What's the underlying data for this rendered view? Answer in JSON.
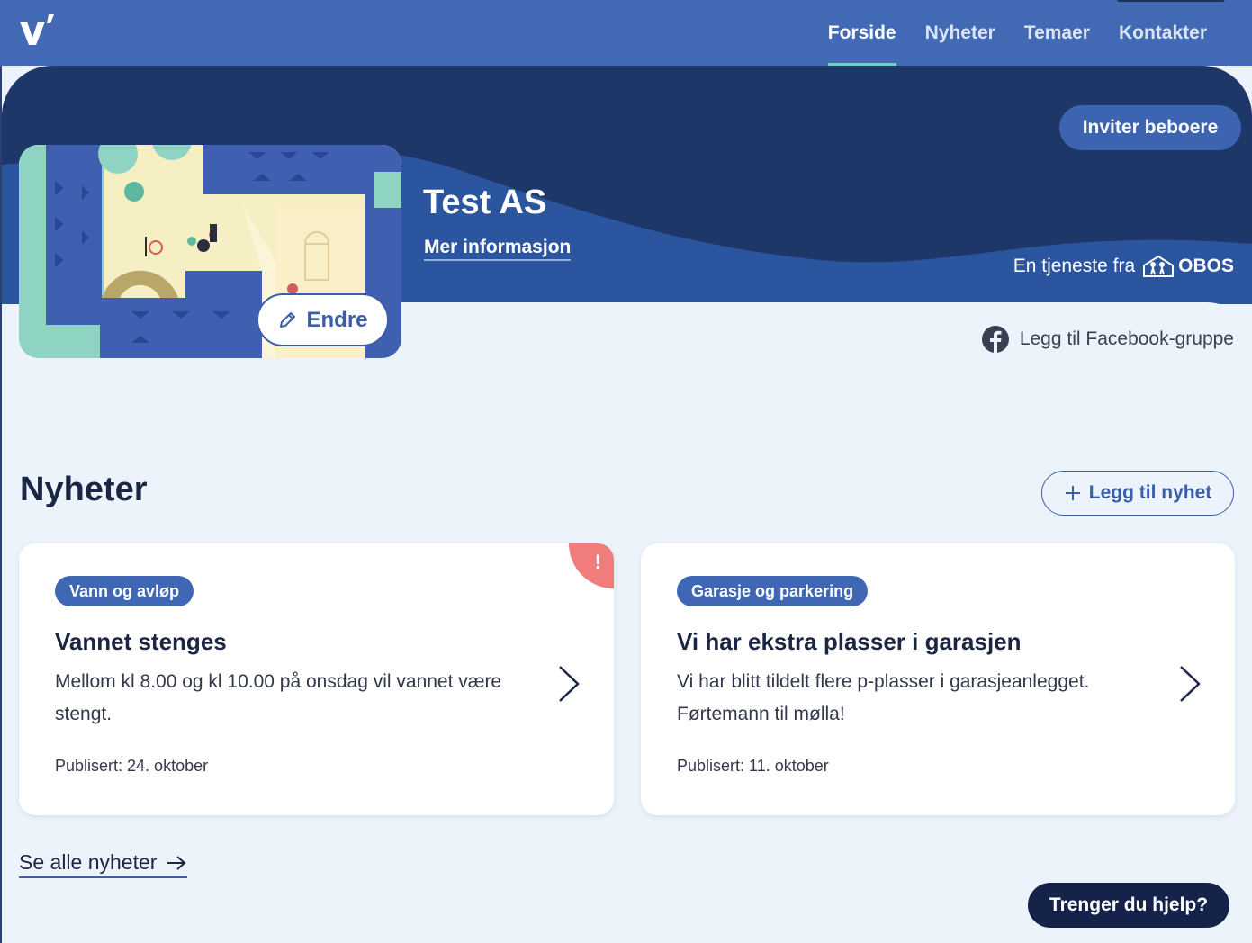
{
  "nav": {
    "logo_name": "v-logo",
    "items": [
      {
        "label": "Forside",
        "active": true
      },
      {
        "label": "Nyheter",
        "active": false
      },
      {
        "label": "Temaer",
        "active": false
      },
      {
        "label": "Kontakter",
        "active": false
      }
    ]
  },
  "hero": {
    "invite_label": "Inviter beboere",
    "org_name": "Test AS",
    "more_info_label": "Mer informasjon",
    "service_by": "En tjeneste fra",
    "brand": "OBOS",
    "edit_label": "Endre",
    "facebook_label": "Legg til Facebook-gruppe"
  },
  "news": {
    "title": "Nyheter",
    "add_label": "Legg til nyhet",
    "cards": [
      {
        "tag": "Vann og avløp",
        "title": "Vannet stenges",
        "body": "Mellom kl 8.00 og kl 10.00 på onsdag vil vannet være stengt.",
        "date": "Publisert: 24. oktober",
        "alert": "!"
      },
      {
        "tag": "Garasje og parkering",
        "title": "Vi har ekstra plasser i garasjen",
        "body": "Vi har blitt tildelt flere p-plasser i garasjeanlegget. Førtemann til mølla!",
        "date": "Publisert: 11. oktober"
      }
    ],
    "see_all_label": "Se alle nyheter"
  },
  "help": {
    "label": "Trenger du hjelp?"
  },
  "colors": {
    "topbar": "#4169b4",
    "hero": "#1e3769",
    "accent": "#3a5fa8",
    "alert": "#f07c7c",
    "active_underline": "#6fd0c0",
    "help_bg": "#15234a"
  }
}
